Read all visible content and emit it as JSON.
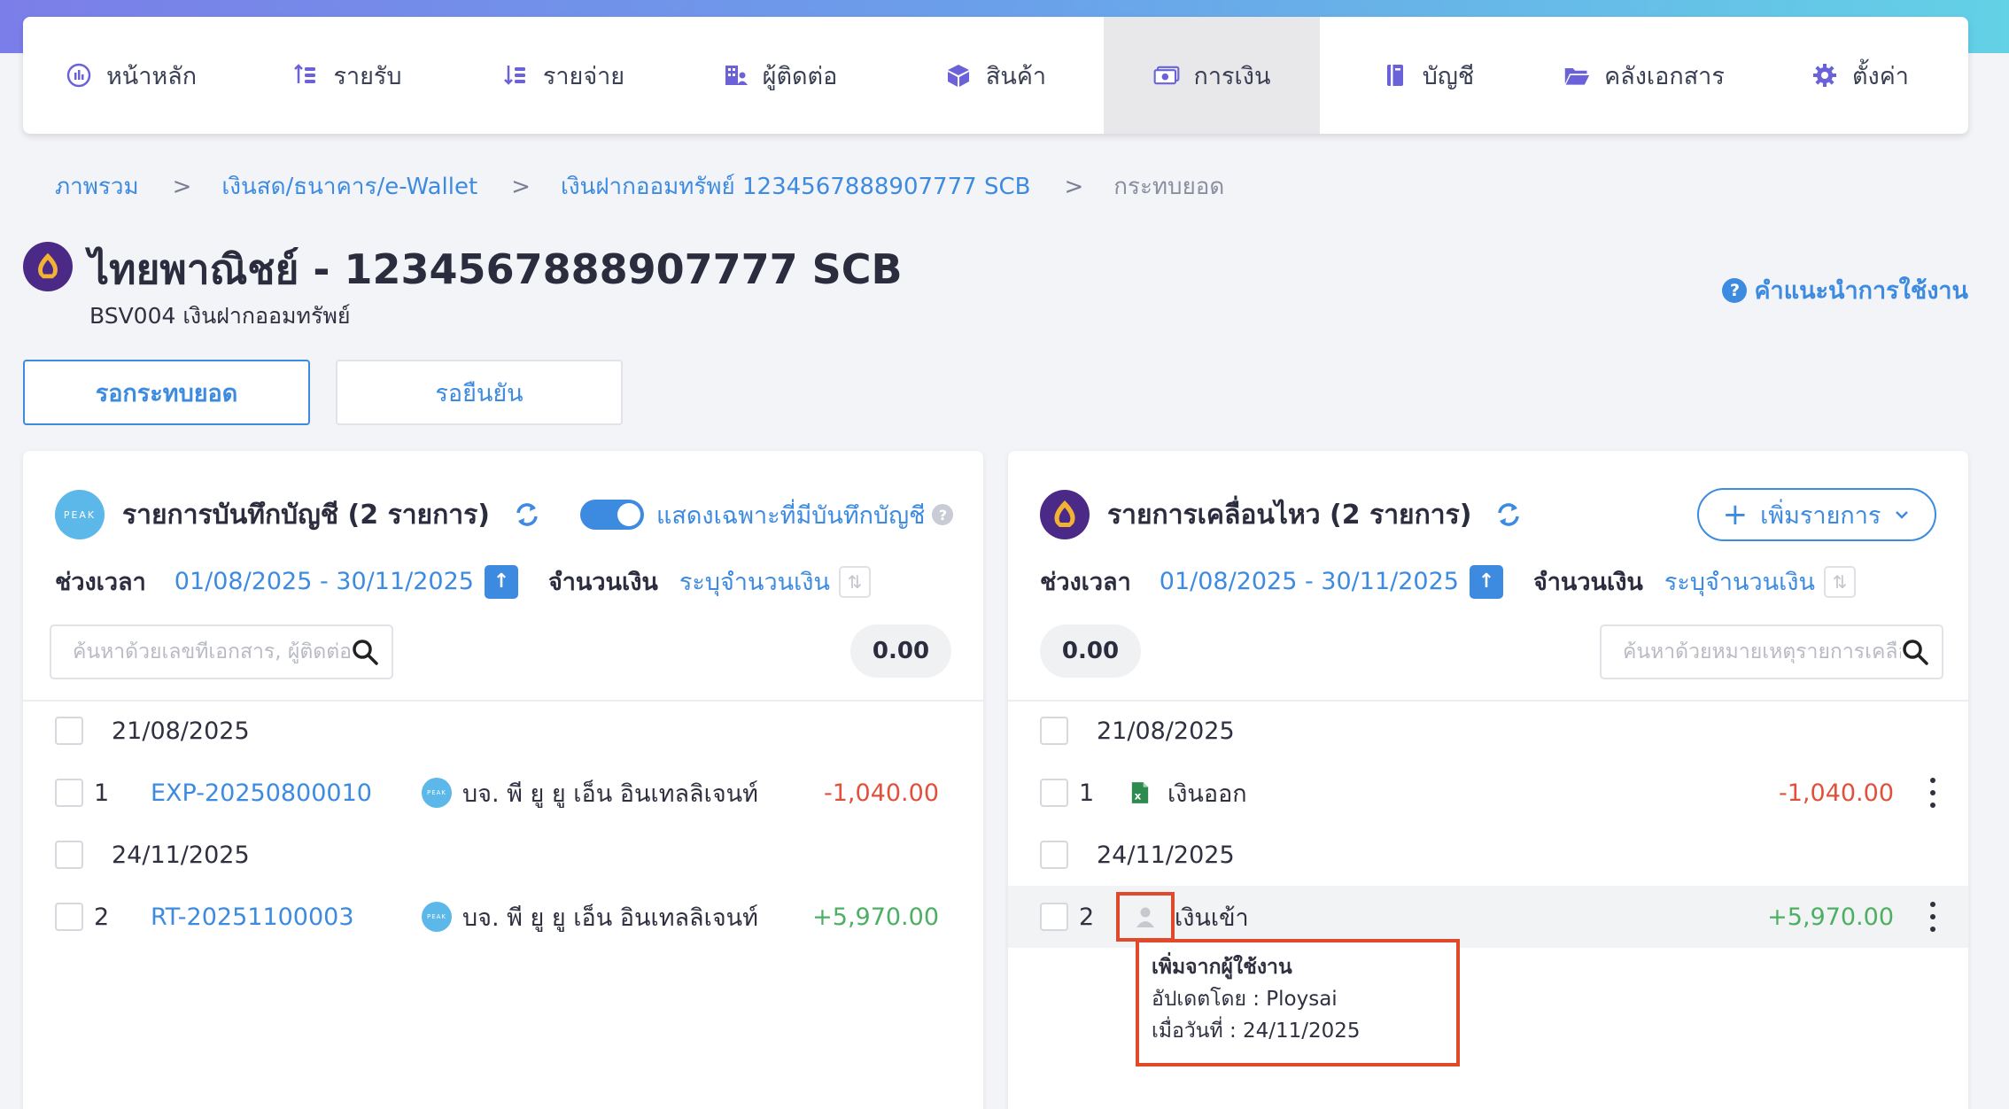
{
  "nav": {
    "items": [
      {
        "label": "หน้าหลัก",
        "icon": "dashboard-icon"
      },
      {
        "label": "รายรับ",
        "icon": "income-icon"
      },
      {
        "label": "รายจ่าย",
        "icon": "expense-icon"
      },
      {
        "label": "ผู้ติดต่อ",
        "icon": "contacts-icon"
      },
      {
        "label": "สินค้า",
        "icon": "box-icon"
      },
      {
        "label": "การเงิน",
        "icon": "money-icon",
        "active": true
      },
      {
        "label": "บัญชี",
        "icon": "ledger-icon"
      },
      {
        "label": "คลังเอกสาร",
        "icon": "folder-icon"
      },
      {
        "label": "ตั้งค่า",
        "icon": "gear-icon"
      }
    ]
  },
  "breadcrumb": {
    "items": [
      "ภาพรวม",
      "เงินสด/ธนาคาร/e-Wallet",
      "เงินฝากออมทรัพย์ 1234567888907777 SCB"
    ],
    "current": "กระทบยอด",
    "separator": ">"
  },
  "page": {
    "title": "ไทยพาณิชย์ - 1234567888907777 SCB",
    "subtitle": "BSV004 เงินฝากออมทรัพย์",
    "help_label": "คำแนะนำการใช้งาน"
  },
  "tabs": {
    "pending_reconcile": "รอกระทบยอด",
    "pending_confirm": "รอยืนยัน"
  },
  "left_panel": {
    "title": "รายการบันทึกบัญชี (2 รายการ)",
    "logo_text": "PEAK",
    "toggle_label": "แสดงเฉพาะที่มีบันทึกบัญชี",
    "toggle_on": true,
    "period_label": "ช่วงเวลา",
    "period_value": "01/08/2025 - 30/11/2025",
    "amount_label": "จำนวนเงิน",
    "amount_link": "ระบุจำนวนเงิน",
    "search_placeholder": "ค้นหาด้วยเลขที่เอกสาร, ผู้ติดต่อ",
    "total": "0.00",
    "groups": [
      {
        "date": "21/08/2025",
        "rows": [
          {
            "num": "1",
            "doc": "EXP-20250800010",
            "contact": "บจ. พี ยู ยู เอ็น อินเทลลิเจนท์",
            "amount": "-1,040.00"
          }
        ]
      },
      {
        "date": "24/11/2025",
        "rows": [
          {
            "num": "2",
            "doc": "RT-20251100003",
            "contact": "บจ. พี ยู ยู เอ็น อินเทลลิเจนท์",
            "amount": "+5,970.00"
          }
        ]
      }
    ]
  },
  "right_panel": {
    "title": "รายการเคลื่อนไหว (2 รายการ)",
    "add_label": "เพิ่มรายการ",
    "period_label": "ช่วงเวลา",
    "period_value": "01/08/2025 - 30/11/2025",
    "amount_label": "จำนวนเงิน",
    "amount_link": "ระบุจำนวนเงิน",
    "search_placeholder": "ค้นหาด้วยหมายเหตุรายการเคลื่อนไหว",
    "total": "0.00",
    "groups": [
      {
        "date": "21/08/2025",
        "rows": [
          {
            "num": "1",
            "desc": "เงินออก",
            "icon": "excel-file-icon",
            "amount": "-1,040.00"
          }
        ]
      },
      {
        "date": "24/11/2025",
        "rows": [
          {
            "num": "2",
            "desc": "เงินเข้า",
            "icon": "user-icon",
            "amount": "+5,970.00"
          }
        ]
      }
    ]
  },
  "tooltip": {
    "title": "เพิ่มจากผู้ใช้งาน",
    "updated_by": "อัปเดตโดย : Ploysai",
    "date": "เมื่อวันที่ : 24/11/2025"
  },
  "colors": {
    "accent": "#3d8be0",
    "negative": "#e0503c",
    "positive": "#4caf62",
    "highlight_border": "#e04a2a",
    "scb_purple": "#4b2a87"
  }
}
